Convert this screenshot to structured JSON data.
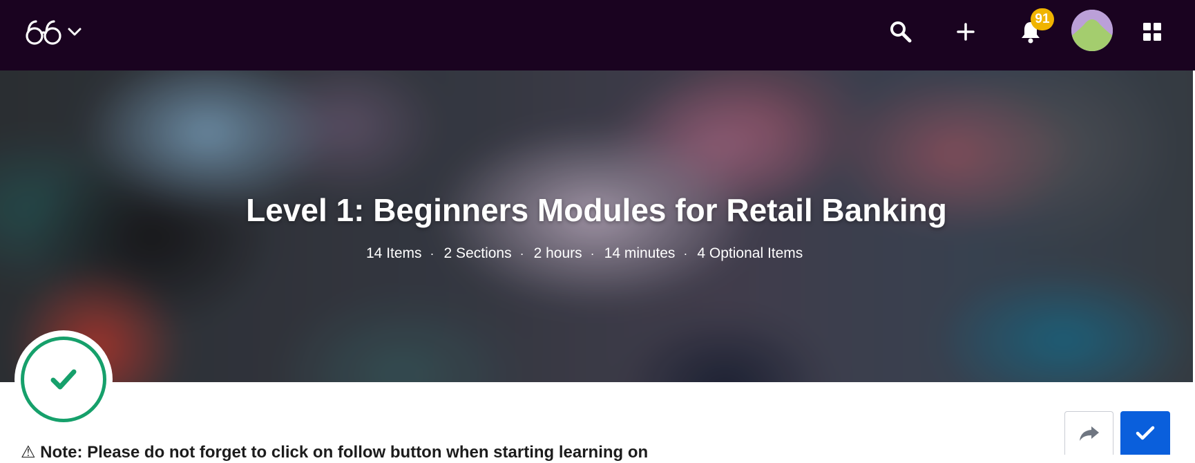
{
  "topbar": {
    "background_color": "#1a0320",
    "logo_icon": "glasses-logo-icon",
    "logo_dropdown_icon": "chevron-down-icon",
    "search_icon": "search-icon",
    "create_icon": "plus-icon",
    "notifications_icon": "bell-icon",
    "notification_count": "91",
    "badge_color": "#f0b400",
    "avatar_icon": "user-avatar",
    "apps_icon": "grid-icon"
  },
  "hero": {
    "title": "Level 1: Beginners Modules for Retail Banking",
    "meta": {
      "items": "14 Items",
      "sections": "2 Sections",
      "hours": "2 hours",
      "minutes": "14 minutes",
      "optional": "4 Optional Items"
    },
    "separator": "·"
  },
  "status": {
    "icon": "check-icon",
    "color": "#16a06b"
  },
  "note": {
    "text": "⚠ Note: Please do not forget to click on follow button when starting learning on"
  },
  "actions": {
    "share_icon": "share-arrow-icon",
    "follow_icon": "check-icon",
    "follow_color": "#0a5fdc"
  }
}
